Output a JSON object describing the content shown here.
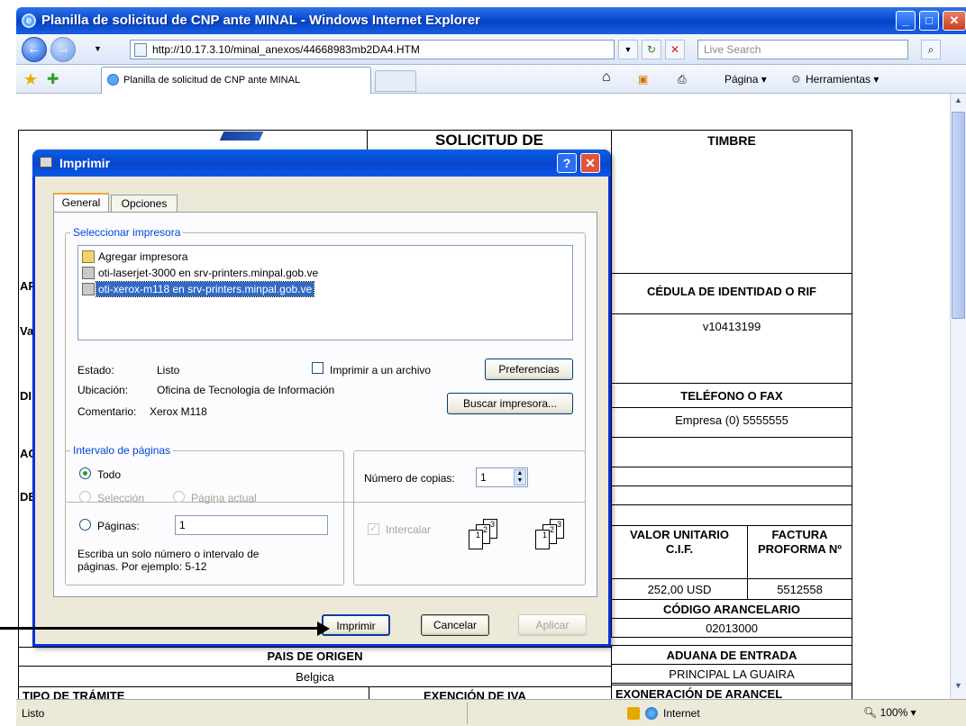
{
  "browser": {
    "title": "Planilla de solicitud de CNP ante MINAL - Windows Internet Explorer",
    "url": "http://10.17.3.10/minal_anexos/44668983mb2DA4.HTM",
    "search_placeholder": "Live Search",
    "tab_label": "Planilla de solicitud de CNP ante MINAL",
    "toolbar": {
      "pagina": "Página",
      "herramientas": "Herramientas"
    },
    "status_text": "Listo",
    "zone": "Internet",
    "zoom": "100%"
  },
  "form": {
    "solicitud": "SOLICITUD DE",
    "timbre": "TIMBRE",
    "cedula_header": "CÉDULA DE IDENTIDAD O RIF",
    "cedula_value": "v10413199",
    "telefono_header": "TELÉFONO O FAX",
    "telefono_value": "Empresa (0) 5555555",
    "valor_header": "VALOR UNITARIO C.I.F.",
    "factura_header": "FACTURA PROFORMA Nº",
    "valor_value": "252,00 USD",
    "factura_value": "5512558",
    "codigo_header": "CÓDIGO ARANCELARIO",
    "codigo_value": "02013000",
    "pais_header": "PAIS DE ORIGEN",
    "pais_value": "Belgica",
    "aduana_header": "ADUANA DE ENTRADA",
    "aduana_value": "PRINCIPAL LA GUAIRA",
    "tipo_header": "TIPO DE TRÁMITE",
    "exencion_header": "EXENCIÓN DE IVA",
    "exoneracion_header": "EXONERACIÓN DE ARANCEL",
    "left_stubs": [
      "AP",
      "Va",
      "DI",
      "AC",
      "DE"
    ]
  },
  "dialog": {
    "title": "Imprimir",
    "tabs": [
      "General",
      "Opciones"
    ],
    "select_printer_legend": "Seleccionar impresora",
    "printers": [
      "Agregar impresora",
      "oti-laserjet-3000 en srv-printers.minpal.gob.ve",
      "oti-xerox-m118 en srv-printers.minpal.gob.ve"
    ],
    "estado_label": "Estado:",
    "estado_value": "Listo",
    "ubicacion_label": "Ubicación:",
    "ubicacion_value": "Oficina de Tecnologia de Información",
    "comentario_label": "Comentario:",
    "comentario_value": "Xerox M118",
    "print_to_file": "Imprimir a un archivo",
    "preferencias": "Preferencias",
    "buscar": "Buscar impresora...",
    "range_legend": "Intervalo de páginas",
    "todo": "Todo",
    "seleccion": "Selección",
    "pagina_actual": "Página actual",
    "paginas": "Páginas:",
    "paginas_value": "1",
    "hint": "Escriba un solo número o intervalo de páginas. Por ejemplo: 5-12",
    "copias_label": "Número de copias:",
    "copias_value": "1",
    "intercalar": "Intercalar",
    "imprimir": "Imprimir",
    "cancelar": "Cancelar",
    "aplicar": "Aplicar"
  }
}
